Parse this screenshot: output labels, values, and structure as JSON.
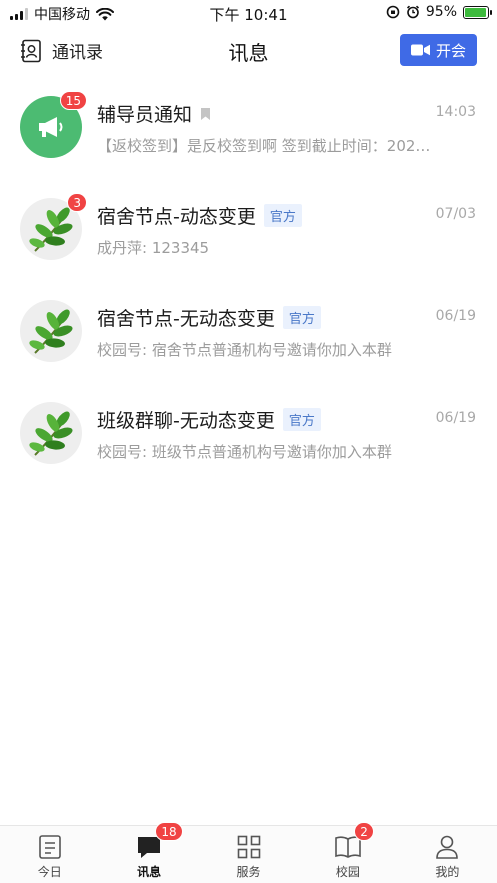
{
  "status_bar": {
    "carrier": "中国移动",
    "time": "下午 10:41",
    "battery": "95%",
    "battery_level": 0.95
  },
  "header": {
    "contacts_label": "通讯录",
    "title": "讯息",
    "meeting_button": "开会"
  },
  "messages": [
    {
      "title": "辅导员通知",
      "badge": "15",
      "time": "14:03",
      "preview": "【返校签到】是反校签到啊 签到截止时间：202…",
      "avatar": "megaphone-icon",
      "bookmark": true
    },
    {
      "title": "宿舍节点-动态变更",
      "badge": "3",
      "tag": "官方",
      "time": "07/03",
      "preview": "成丹萍: 123345",
      "avatar": "leaf-icon"
    },
    {
      "title": "宿舍节点-无动态变更",
      "tag": "官方",
      "time": "06/19",
      "preview": "校园号:  宿舍节点普通机构号邀请你加入本群",
      "avatar": "leaf-icon"
    },
    {
      "title": "班级群聊-无动态变更",
      "tag": "官方",
      "time": "06/19",
      "preview": "校园号:  班级节点普通机构号邀请你加入本群",
      "avatar": "leaf-icon"
    }
  ],
  "tabbar": {
    "tabs": [
      {
        "label": "今日",
        "icon": "today-icon"
      },
      {
        "label": "讯息",
        "icon": "message-icon",
        "badge": "18",
        "active": true
      },
      {
        "label": "服务",
        "icon": "grid-icon"
      },
      {
        "label": "校园",
        "icon": "book-icon",
        "badge": "2"
      },
      {
        "label": "我的",
        "icon": "profile-icon"
      }
    ]
  },
  "colors": {
    "accent": "#3f6ae6",
    "badge": "#f04343",
    "notice_avatar": "#4cbb72",
    "tag_text": "#4a78c8",
    "tag_bg": "#eaf1fd"
  }
}
